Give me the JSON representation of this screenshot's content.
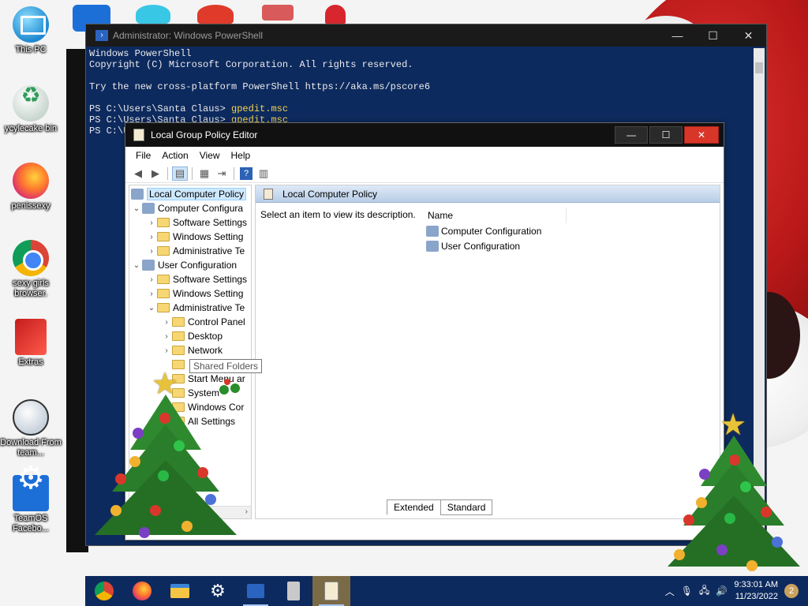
{
  "desktop": {
    "icons": [
      {
        "label": "This PC",
        "icon": "this-pc-icon"
      },
      {
        "label": "ycylecake bin",
        "icon": "recycle-bin-icon"
      },
      {
        "label": "penissexy",
        "icon": "firefox-icon"
      },
      {
        "label": "sexy girls browser.",
        "icon": "chrome-icon"
      },
      {
        "label": "Extras",
        "icon": "extras-icon"
      },
      {
        "label": "Download From team...",
        "icon": "download-icon"
      },
      {
        "label": "TeamOS Facebo...",
        "icon": "settings-gear-icon"
      }
    ]
  },
  "powershell": {
    "title": "Administrator: Windows PowerShell",
    "lines": [
      "Windows PowerShell",
      "Copyright (C) Microsoft Corporation. All rights reserved.",
      "",
      "Try the new cross-platform PowerShell https://aka.ms/pscore6",
      ""
    ],
    "prompt1": "PS C:\\Users\\Santa Claus> ",
    "cmd1": "gpedit.msc",
    "prompt2": "PS C:\\Users\\Santa Claus> ",
    "cmd2": "gpedit.msc",
    "prompt3": "PS C:\\U"
  },
  "gpedit": {
    "title": "Local Group Policy Editor",
    "menu": [
      "File",
      "Action",
      "View",
      "Help"
    ],
    "tree": [
      {
        "label": "Local Computer Policy",
        "depth": 0,
        "arrow": "",
        "type": "root",
        "selected": true
      },
      {
        "label": "Computer Configura",
        "depth": 0,
        "arrow": "v",
        "type": "node"
      },
      {
        "label": "Software Settings",
        "depth": 1,
        "arrow": ">",
        "type": "folder"
      },
      {
        "label": "Windows Setting",
        "depth": 1,
        "arrow": ">",
        "type": "folder"
      },
      {
        "label": "Administrative Te",
        "depth": 1,
        "arrow": ">",
        "type": "folder"
      },
      {
        "label": "User Configuration",
        "depth": 0,
        "arrow": "v",
        "type": "node"
      },
      {
        "label": "Software Settings",
        "depth": 1,
        "arrow": ">",
        "type": "folder"
      },
      {
        "label": "Windows Setting",
        "depth": 1,
        "arrow": ">",
        "type": "folder"
      },
      {
        "label": "Administrative Te",
        "depth": 1,
        "arrow": "v",
        "type": "folder"
      },
      {
        "label": "Control Panel",
        "depth": 2,
        "arrow": ">",
        "type": "folder"
      },
      {
        "label": "Desktop",
        "depth": 2,
        "arrow": ">",
        "type": "folder"
      },
      {
        "label": "Network",
        "depth": 2,
        "arrow": ">",
        "type": "folder"
      },
      {
        "label": "",
        "depth": 2,
        "arrow": "",
        "type": "folder"
      },
      {
        "label": "Start Menu ar",
        "depth": 2,
        "arrow": "",
        "type": "folder"
      },
      {
        "label": "System",
        "depth": 2,
        "arrow": "",
        "type": "folder"
      },
      {
        "label": "Windows Cor",
        "depth": 2,
        "arrow": "",
        "type": "folder"
      },
      {
        "label": "All Settings",
        "depth": 2,
        "arrow": "",
        "type": "folder"
      }
    ],
    "tooltip": "Shared Folders",
    "right_header": "Local Computer Policy",
    "description": "Select an item to view its description.",
    "column_name": "Name",
    "items": [
      "Computer Configuration",
      "User Configuration"
    ],
    "tabs": [
      "Extended",
      "Standard"
    ]
  },
  "taskbar": {
    "apps": [
      "chrome-icon",
      "firefox-icon",
      "file-explorer-icon",
      "settings-icon",
      "powershell-icon",
      "server-manager-icon",
      "group-policy-icon"
    ],
    "time": "9:33:01 AM",
    "date": "11/23/2022",
    "notifications": "2"
  }
}
